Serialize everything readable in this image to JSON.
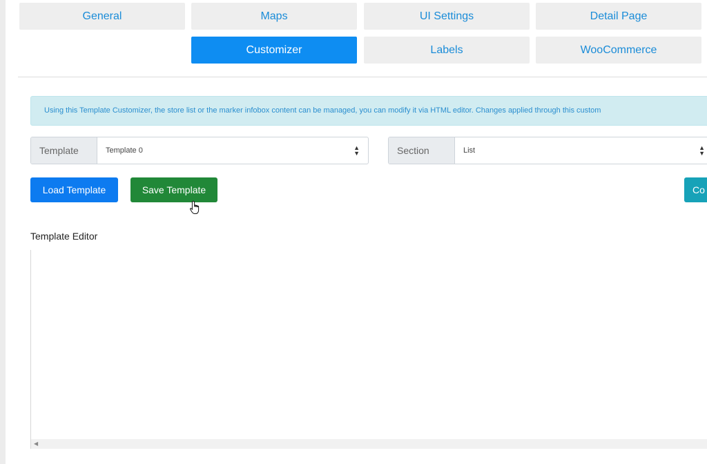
{
  "tabs": {
    "row1": [
      {
        "label": "General"
      },
      {
        "label": "Maps"
      },
      {
        "label": "UI Settings"
      },
      {
        "label": "Detail Page"
      }
    ],
    "row2": [
      {
        "label": "Customizer",
        "active": true
      },
      {
        "label": "Labels"
      },
      {
        "label": "WooCommerce"
      }
    ]
  },
  "info": {
    "text": "Using this Template Customizer, the store list or the marker infobox content can be managed, you can modify it via HTML editor. Changes applied through this custom"
  },
  "template_select": {
    "addon": "Template",
    "value": "Template 0"
  },
  "section_select": {
    "addon": "Section",
    "value": "List"
  },
  "buttons": {
    "load": "Load Template",
    "save": "Save Template",
    "third_partial": "Co"
  },
  "editor": {
    "label": "Template Editor"
  },
  "colors": {
    "primary": "#0d7bf0",
    "success": "#218838",
    "info": "#17a2b8",
    "tab_active": "#0e8df2",
    "tab_text": "#1a8cd8",
    "alert_bg": "#d1ecf1"
  },
  "icons": {
    "select_caret": "sort-caret-icon",
    "cursor": "hand-pointer-icon",
    "scroll_left": "scroll-left-arrow-icon"
  }
}
